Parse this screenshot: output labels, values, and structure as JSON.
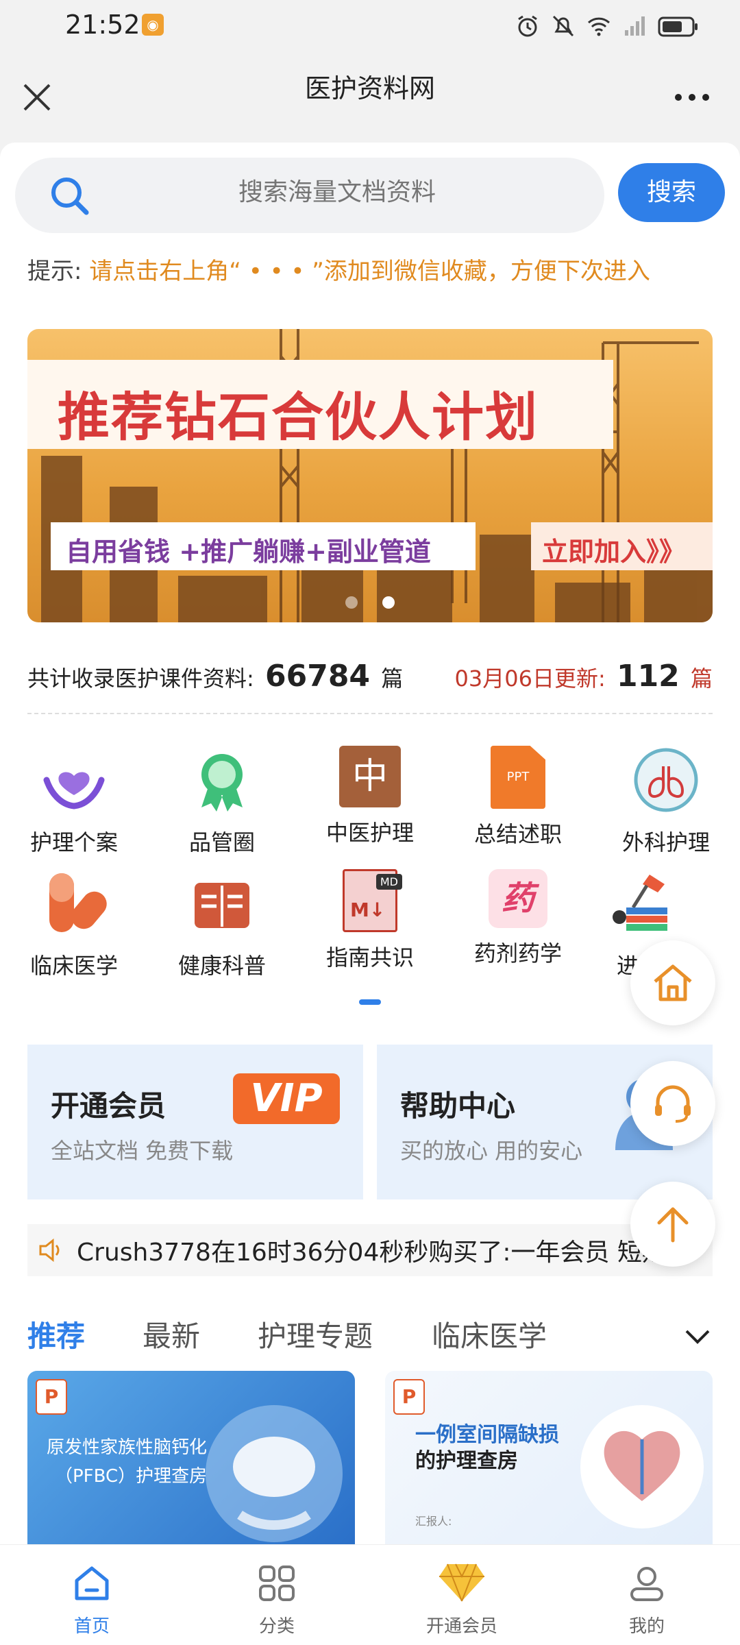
{
  "status_bar": {
    "time": "21:52",
    "icons": [
      "alarm-icon",
      "mute-icon",
      "wifi-icon",
      "signal-icon",
      "battery-icon"
    ]
  },
  "title_bar": {
    "title": "医护资料网"
  },
  "search": {
    "placeholder": "搜索海量文档资料",
    "button_label": "搜索"
  },
  "tip": {
    "label": "提示:",
    "text": "请点击右上角“ • • • ”添加到微信收藏，方便下次进入"
  },
  "banner": {
    "title": "推荐钻石合伙人计划",
    "subtitle": "自用省钱 +推广躺赚+副业管道",
    "cta": "立即加入》》",
    "slide_count": 2,
    "active_slide": 2
  },
  "stats": {
    "total_prefix": "共计收录医护课件资料:",
    "total_count": "66784",
    "total_unit": "篇",
    "update_prefix": "03月06日更新:",
    "update_count": "112",
    "update_unit": "篇"
  },
  "categories": [
    {
      "label": "护理个案",
      "icon": "heart-hands-icon"
    },
    {
      "label": "品管圈",
      "icon": "award-ribbon-icon"
    },
    {
      "label": "中医护理",
      "icon": "zhong-icon"
    },
    {
      "label": "总结述职",
      "icon": "ppt-file-icon"
    },
    {
      "label": "外科护理",
      "icon": "lungs-icon"
    },
    {
      "label": "临床医学",
      "icon": "capsule-icon"
    },
    {
      "label": "健康科普",
      "icon": "book-icon"
    },
    {
      "label": "指南共识",
      "icon": "md-file-icon"
    },
    {
      "label": "药剂药学",
      "icon": "yao-icon"
    },
    {
      "label": "进",
      "icon": "desk-lamp-icon"
    }
  ],
  "category_glyphs": {
    "zhong": "中",
    "yao": "药",
    "ppt": "PPT",
    "md": "MD",
    "md_big": "M↓"
  },
  "cards": {
    "vip": {
      "title": "开通会员",
      "subtitle": "全站文档 免费下载",
      "badge": "VIP"
    },
    "help": {
      "title": "帮助中心",
      "subtitle": "买的放心 用的安心"
    }
  },
  "notice": {
    "text": "Crush3778在16时36分04秒秒购买了:一年会员 短期"
  },
  "tabs": [
    "推荐",
    "最新",
    "护理专题",
    "临床医学"
  ],
  "thumbnails": [
    {
      "badge": "P",
      "title_line1": "原发性家族性脑钙化",
      "title_line2": "（PFBC）护理查房"
    },
    {
      "badge": "P",
      "title_line1": "一例室间隔缺损",
      "title_line2": "的护理查房",
      "footer": "汇报人:"
    }
  ],
  "bottom_nav": [
    {
      "label": "首页",
      "icon": "home-icon"
    },
    {
      "label": "分类",
      "icon": "grid-icon"
    },
    {
      "label": "开通会员",
      "icon": "diamond-icon"
    },
    {
      "label": "我的",
      "icon": "user-icon"
    }
  ],
  "colors": {
    "accent": "#2f7fe8",
    "tip": "#e08a1f",
    "banner_title": "#d83a3a",
    "banner_sub": "#7b3d9e",
    "update_red": "#c0392b"
  }
}
